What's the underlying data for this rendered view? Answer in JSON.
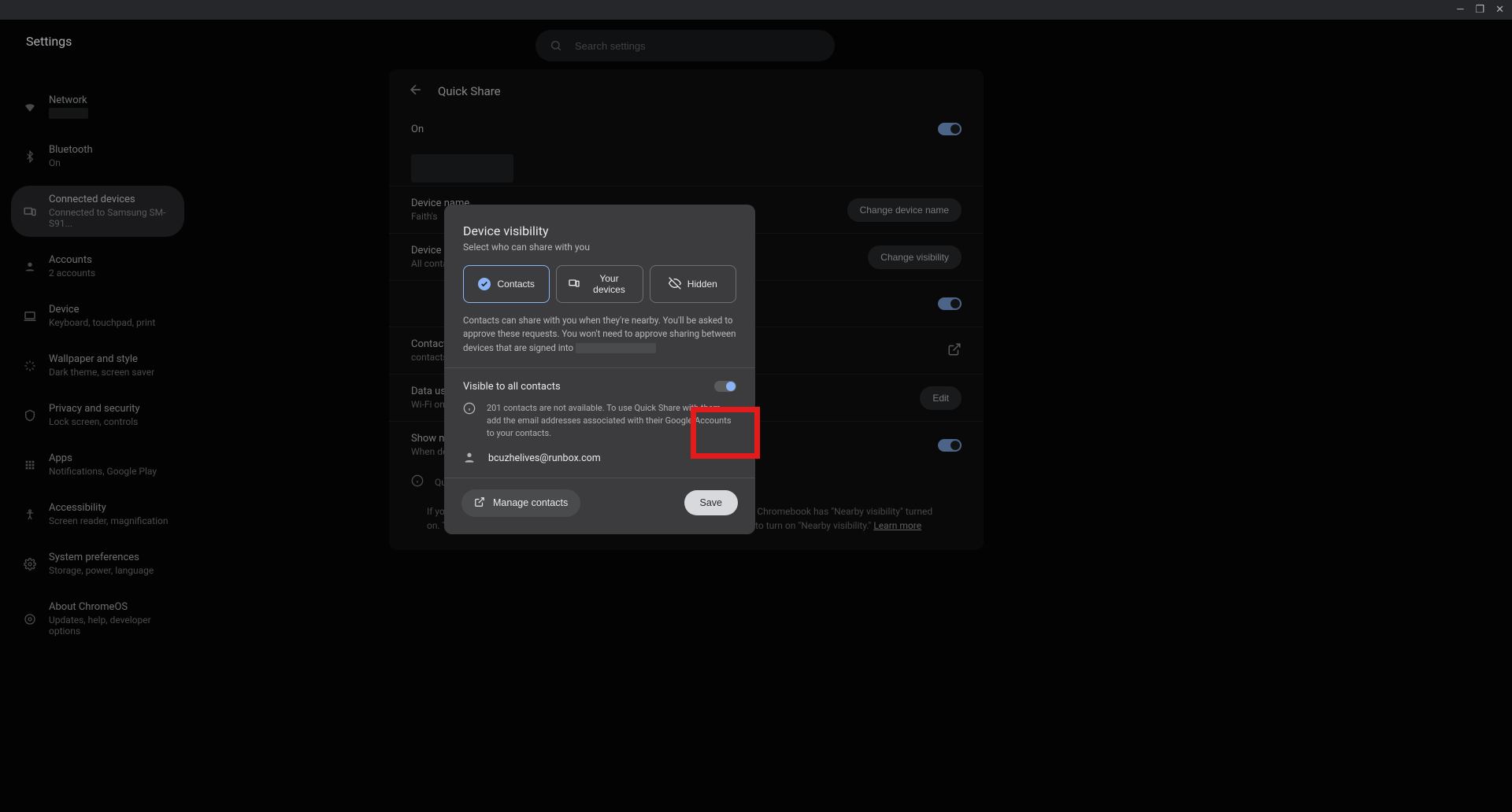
{
  "app": {
    "title": "Settings"
  },
  "search": {
    "placeholder": "Search settings"
  },
  "sidebar": {
    "items": [
      {
        "label": "Network",
        "sub": ""
      },
      {
        "label": "Bluetooth",
        "sub": "On"
      },
      {
        "label": "Connected devices",
        "sub": "Connected to Samsung SM-S91..."
      },
      {
        "label": "Accounts",
        "sub": "2 accounts"
      },
      {
        "label": "Device",
        "sub": "Keyboard, touchpad, print"
      },
      {
        "label": "Wallpaper and style",
        "sub": "Dark theme, screen saver"
      },
      {
        "label": "Privacy and security",
        "sub": "Lock screen, controls"
      },
      {
        "label": "Apps",
        "sub": "Notifications, Google Play"
      },
      {
        "label": "Accessibility",
        "sub": "Screen reader, magnification"
      },
      {
        "label": "System preferences",
        "sub": "Storage, power, language"
      },
      {
        "label": "About ChromeOS",
        "sub": "Updates, help, developer options"
      }
    ]
  },
  "content": {
    "page_title": "Quick Share",
    "on_label": "On",
    "device_name": {
      "label": "Device name",
      "sub": "Faith's",
      "action": "Change device name"
    },
    "visibility": {
      "label": "Device visibility",
      "sub": "All contacts",
      "action": "Change visibility"
    },
    "contacts": {
      "label": "Contacts",
      "sub": "contacts"
    },
    "data": {
      "label": "Data usage",
      "sub": "Wi-Fi only",
      "action": "Edit"
    },
    "notif": {
      "label": "Show notification",
      "sub": "When devices are sharing nearby"
    },
    "quick_info": "Quick Share",
    "footer": "If you're sharing with a Chromebook that is not in your contacts, make sure the Chromebook has \"Nearby visibility\" turned on. To turn on \"Nearby visibility,\" select the bottom right corner and then select to turn on \"Nearby visibility.\"",
    "learn_more": "Learn more"
  },
  "dialog": {
    "title": "Device visibility",
    "subtitle": "Select who can share with you",
    "options": {
      "contacts": "Contacts",
      "devices": "Your devices",
      "hidden": "Hidden"
    },
    "help": "Contacts can share with you when they're nearby. You'll be asked to approve these requests. You won't need to approve sharing between devices that are signed into",
    "visible_all": "Visible to all contacts",
    "contacts_warning": "201 contacts are not available. To use Quick Share with them, add the email addresses associated with their Google Accounts to your contacts.",
    "email": "bcuzhelives@runbox.com",
    "manage": "Manage contacts",
    "save": "Save"
  }
}
